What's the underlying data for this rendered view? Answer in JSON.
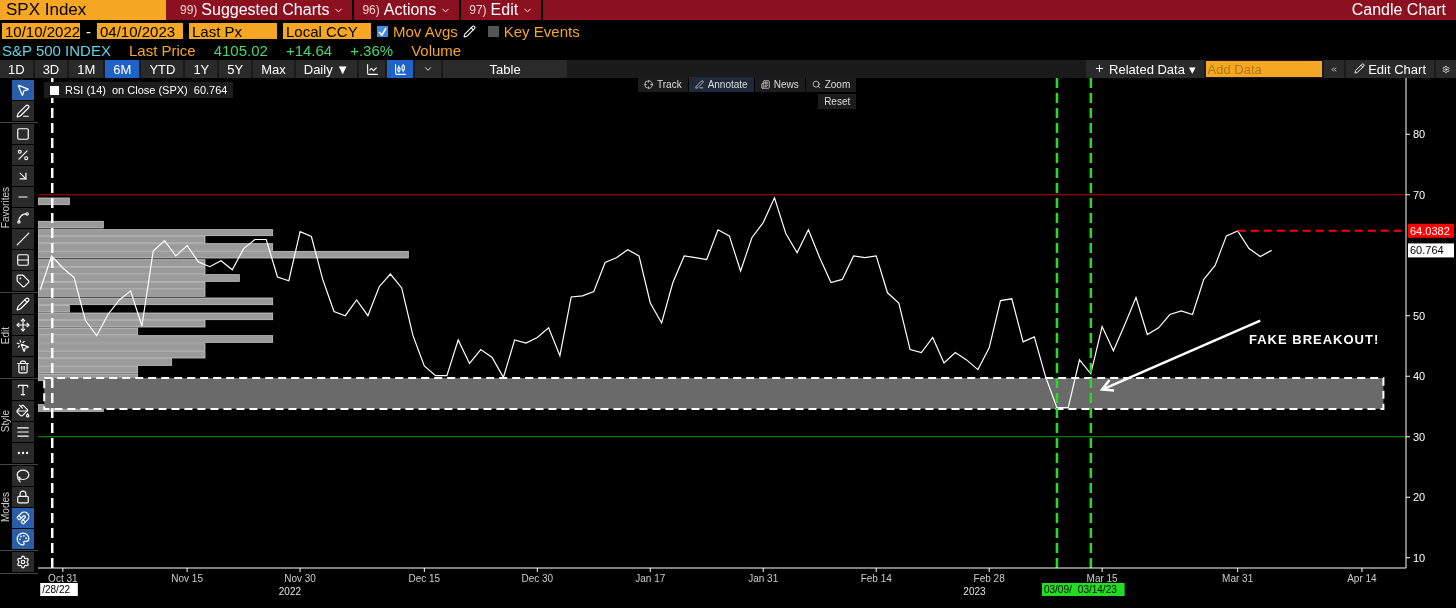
{
  "header": {
    "ticker": "SPX Index",
    "menus": [
      {
        "number": "99)",
        "label": "Suggested Charts"
      },
      {
        "number": "96)",
        "label": "Actions"
      },
      {
        "number": "97)",
        "label": "Edit"
      }
    ],
    "title": "Candle Chart"
  },
  "settings": {
    "start_date": "10/10/2022",
    "separator": "-",
    "end_date": "04/10/2023",
    "price_field": "Last Px",
    "currency": "Local CCY",
    "options": [
      {
        "label": "Mov Avgs",
        "checked": true
      },
      {
        "label": "Key Events",
        "checked": false
      }
    ]
  },
  "quote": {
    "name": "S&P 500 INDEX",
    "price_label": "Last Price",
    "price": "4105.02",
    "change": "+14.64",
    "change_pct": "+.36%",
    "volume_label": "Volume"
  },
  "toolbar": {
    "periods": [
      {
        "label": "1D",
        "selected": false
      },
      {
        "label": "3D",
        "selected": false
      },
      {
        "label": "1M",
        "selected": false
      },
      {
        "label": "6M",
        "selected": true
      },
      {
        "label": "YTD",
        "selected": false
      },
      {
        "label": "1Y",
        "selected": false
      },
      {
        "label": "5Y",
        "selected": false
      },
      {
        "label": "Max",
        "selected": false
      }
    ],
    "frequency": "Daily ▼",
    "chart_types": [
      {
        "kind": "line",
        "selected": false
      },
      {
        "kind": "candle",
        "selected": true
      }
    ],
    "table": "Table",
    "related": "Related Data",
    "related_caret": "▾",
    "add_data_placeholder": "Add Data",
    "edit_chart": "Edit Chart"
  },
  "drawing_tools": [
    {
      "tools": [
        {
          "kind": "pointer",
          "selected": true
        },
        {
          "kind": "pen",
          "selected": false
        }
      ]
    },
    {
      "label": "Favorites",
      "tools": [
        {
          "kind": "rectangle",
          "selected": false
        },
        {
          "kind": "percent",
          "selected": false
        },
        {
          "kind": "arrow",
          "selected": false
        },
        {
          "kind": "hline",
          "selected": false
        },
        {
          "kind": "ray",
          "selected": false
        },
        {
          "kind": "segment",
          "selected": false
        },
        {
          "kind": "channel",
          "selected": false
        },
        {
          "kind": "price-label",
          "selected": false
        }
      ]
    },
    {
      "label": "Edit",
      "tools": [
        {
          "kind": "pencil",
          "selected": false
        },
        {
          "kind": "move",
          "selected": false
        },
        {
          "kind": "add-pointer",
          "selected": false
        },
        {
          "kind": "trash",
          "selected": false
        }
      ]
    },
    {
      "label": "Style",
      "tools": [
        {
          "kind": "text",
          "selected": false
        },
        {
          "kind": "fill",
          "selected": false
        },
        {
          "kind": "line-width",
          "selected": false
        },
        {
          "kind": "line-style",
          "selected": false
        }
      ]
    },
    {
      "label": "Modes",
      "tools": [
        {
          "kind": "lasso",
          "selected": false
        },
        {
          "kind": "lock",
          "selected": false
        },
        {
          "kind": "magnet",
          "selected": true
        },
        {
          "kind": "color",
          "selected": true
        }
      ]
    },
    {
      "tools": [
        {
          "kind": "gear",
          "selected": false
        }
      ]
    }
  ],
  "chart": {
    "legend": {
      "source": "on Close (SPX)",
      "value": "60.764"
    },
    "modes": [
      {
        "label": "Track",
        "kind": "track",
        "selected": false
      },
      {
        "label": "Annotate",
        "kind": "annotate",
        "selected": true
      },
      {
        "label": "News",
        "kind": "news",
        "selected": false
      },
      {
        "label": "Zoom",
        "kind": "zoom",
        "selected": false
      }
    ],
    "reset": "Reset",
    "year_labels": [
      "2022",
      "2023"
    ],
    "date_markers": [
      {
        "label": "/28/22",
        "color": "#ffffff"
      },
      {
        "label": "03/09/",
        "color": "#22dd22"
      },
      {
        "label": "03/14/23",
        "color": "#22dd22"
      }
    ],
    "last_value": "60.764",
    "chart_data": {
      "type": "line",
      "categories": [
        null,
        null,
        "Oct 31",
        null,
        null,
        null,
        null,
        null,
        null,
        null,
        null,
        null,
        null,
        "Nov 15",
        null,
        null,
        null,
        null,
        null,
        null,
        null,
        null,
        null,
        "Nov 30",
        null,
        null,
        null,
        null,
        null,
        null,
        null,
        null,
        null,
        null,
        "Dec 15",
        null,
        null,
        null,
        null,
        null,
        null,
        null,
        null,
        null,
        "Dec 30",
        null,
        null,
        null,
        null,
        null,
        null,
        null,
        null,
        null,
        "Jan 17",
        null,
        null,
        null,
        null,
        null,
        null,
        null,
        null,
        null,
        "Jan 31",
        null,
        null,
        null,
        null,
        null,
        null,
        null,
        null,
        null,
        "Feb 14",
        null,
        null,
        null,
        null,
        null,
        null,
        null,
        null,
        null,
        "Feb 28",
        null,
        null,
        null,
        null,
        null,
        null,
        null,
        null,
        null,
        "Mar 15",
        null,
        null,
        null,
        null,
        null,
        null,
        null,
        null,
        null,
        null,
        null,
        "Mar 31",
        null,
        null,
        null,
        null,
        null,
        null,
        null,
        null,
        null,
        null,
        "Apr 14"
      ],
      "ylim": [
        8.3,
        89.3
      ],
      "yticks": [
        10,
        20,
        30,
        40,
        50,
        70,
        80
      ],
      "series": [
        {
          "name": "RSI (14)",
          "color": "#ffffff",
          "values": [
            54.3,
            59.9,
            57.9,
            56.3,
            49.2,
            46.7,
            50.2,
            52.6,
            54.1,
            48.3,
            60.7,
            62.4,
            59.9,
            61.6,
            58.9,
            58.1,
            59.1,
            57.6,
            61.1,
            62.6,
            62.6,
            56.4,
            55.8,
            63.9,
            63.1,
            56.0,
            50.7,
            50.0,
            52.6,
            50.0,
            54.8,
            56.9,
            54.6,
            46.7,
            41.7,
            40.1,
            40.1,
            46.0,
            42.1,
            44.4,
            43.1,
            39.8,
            46.0,
            45.5,
            46.4,
            48.0,
            43.4,
            53.1,
            53.3,
            54.0,
            58.8,
            59.6,
            60.9,
            59.9,
            52.1,
            48.8,
            55.5,
            59.9,
            59.6,
            59.3,
            64.2,
            63.2,
            57.4,
            62.9,
            65.4,
            69.5,
            63.6,
            60.4,
            64.2,
            59.6,
            55.5,
            56.0,
            59.9,
            59.6,
            59.9,
            53.8,
            52.1,
            44.4,
            43.9,
            46.4,
            42.2,
            43.9,
            42.7,
            41.1,
            44.7,
            52.5,
            52.8,
            45.7,
            46.5,
            39.9,
            34.8,
            34.8,
            42.7,
            40.4,
            48.2,
            44.2,
            48.5,
            53.0,
            46.9,
            48.0,
            50.2,
            50.8,
            50.2,
            56.0,
            58.3,
            63.2,
            64.0,
            61.1,
            59.8,
            60.8,
            null,
            null,
            null,
            null,
            null,
            null,
            null,
            null
          ]
        }
      ],
      "ref_lines": [
        {
          "axis": "y",
          "value": 70,
          "color": "#c00000"
        },
        {
          "axis": "y",
          "value": 30,
          "color": "#00a000"
        },
        {
          "axis": "y",
          "value": 64.0382,
          "color": "#ff0000",
          "label": "64.0382"
        }
      ],
      "bands": [
        {
          "axis": "y",
          "from": 34.6,
          "to": 39.7
        }
      ],
      "annotations": [
        "FAKE BREAKOUT!"
      ]
    }
  }
}
